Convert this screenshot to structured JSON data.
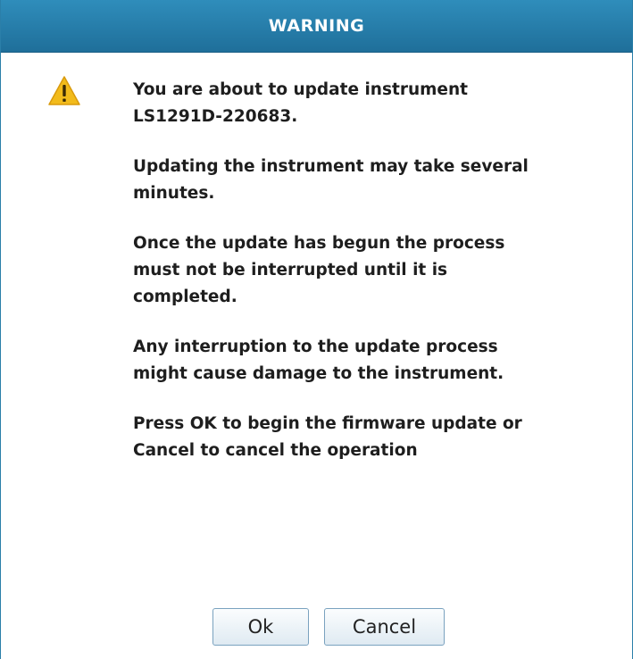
{
  "dialog": {
    "title": "WARNING",
    "icon": "warning-triangle-icon",
    "accent_color": "#2f8dbb",
    "messages": [
      "You are about to update instrument\nLS1291D-220683.",
      "Updating the instrument may take several\nminutes.",
      "Once the update has begun the process\nmust not be interrupted until it is\ncompleted.",
      "Any interruption to the update process\nmight cause damage to the instrument.",
      "Press OK to begin the firmware update or\nCancel to cancel the operation"
    ],
    "buttons": {
      "ok_label": "Ok",
      "cancel_label": "Cancel"
    }
  }
}
